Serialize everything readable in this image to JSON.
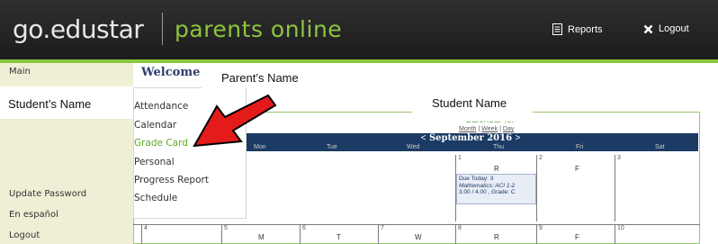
{
  "header": {
    "logo_text": "go.edustar",
    "tagline": "parents online",
    "reports_label": "Reports",
    "logout_label": "Logout"
  },
  "sidebar": {
    "items": [
      {
        "label": "Main"
      },
      {
        "label": "Update Password"
      },
      {
        "label": "En español"
      },
      {
        "label": "Logout"
      }
    ]
  },
  "main": {
    "welcome": "Welcome"
  },
  "menu": {
    "items": [
      {
        "label": "Attendance"
      },
      {
        "label": "Calendar"
      },
      {
        "label": "Grade Card"
      },
      {
        "label": "Personal"
      },
      {
        "label": "Progress Report"
      },
      {
        "label": "Schedule"
      }
    ]
  },
  "annotations": {
    "parent_name": "Parent’s Name",
    "student_label": "Student’s Name",
    "student_name": "Student Name"
  },
  "calendar": {
    "title": "Calendar for",
    "views": [
      "Month",
      "Week",
      "Day"
    ],
    "view_separator": "|",
    "prev": "<",
    "next": ">",
    "month_year": "September  2016",
    "days_of_week": [
      "Mon",
      "Tue",
      "Wed",
      "Thu",
      "Fri",
      "Sat"
    ],
    "week1": {
      "numbers": [
        "1",
        "2",
        "3"
      ],
      "letters": [
        "R",
        "F"
      ]
    },
    "week2": {
      "numbers": [
        "4",
        "5",
        "6",
        "7",
        "8",
        "9",
        "10"
      ],
      "letters": [
        "M",
        "T",
        "W",
        "R",
        "F"
      ]
    },
    "due": {
      "heading": "Due Today: 3",
      "course": "Mathematics: ACI 1-2",
      "score": "3.00 / 4.00 , Grade: C"
    }
  },
  "colors": {
    "header_bg": "#222222",
    "accent_green": "#8cc63f",
    "sidebar_bg": "#efefd6",
    "calendar_bar": "#1c3b64",
    "arrow_red": "#e31b1b"
  }
}
